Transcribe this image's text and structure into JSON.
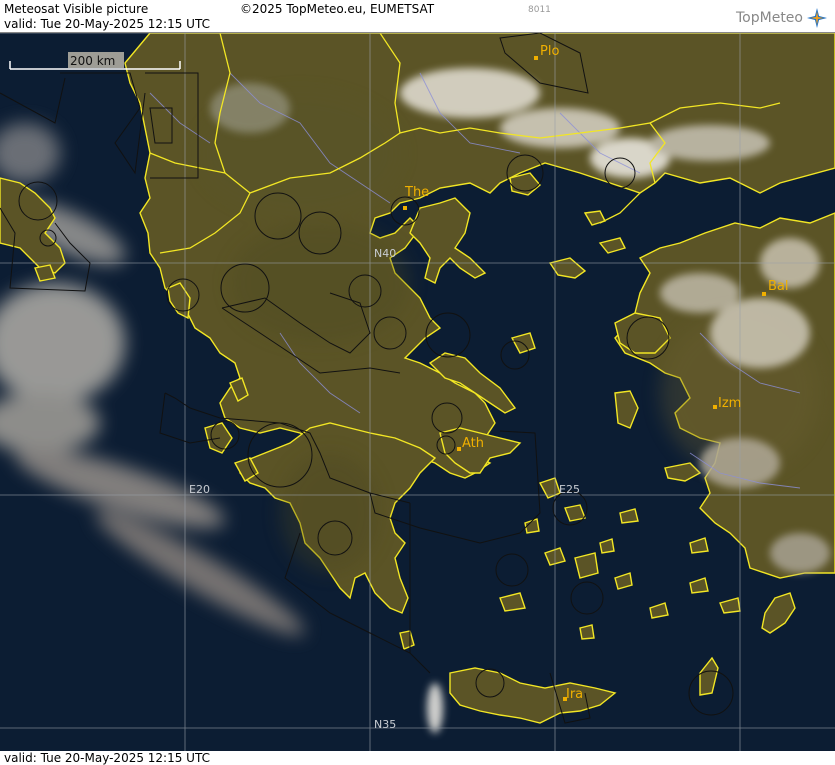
{
  "header": {
    "title": "Meteosat Visible picture",
    "copyright": "©2025 TopMeteo.eu, EUMETSAT",
    "valid": "valid:  Tue  20-May-2025  12:15 UTC",
    "code": "8011",
    "logo": "TopMeteo"
  },
  "footer": {
    "valid": "valid:  Tue  20-May-2025  12:15 UTC"
  },
  "scale": {
    "label": "200 km"
  },
  "grid": {
    "lat_labels": [
      "N40",
      "N35"
    ],
    "lon_labels": [
      "E20",
      "E25"
    ]
  },
  "cities": [
    {
      "name": "Plo"
    },
    {
      "name": "The"
    },
    {
      "name": "Bal"
    },
    {
      "name": "Izm"
    },
    {
      "name": "Ath"
    },
    {
      "name": "Ira"
    }
  ],
  "colors": {
    "sea": "#0c1d33",
    "land": "#5b5426",
    "coast": "#f2e624",
    "border": "#f2e624",
    "city": "#f0b000",
    "grid": "#9aa0a8",
    "river": "#8c8fd8"
  }
}
